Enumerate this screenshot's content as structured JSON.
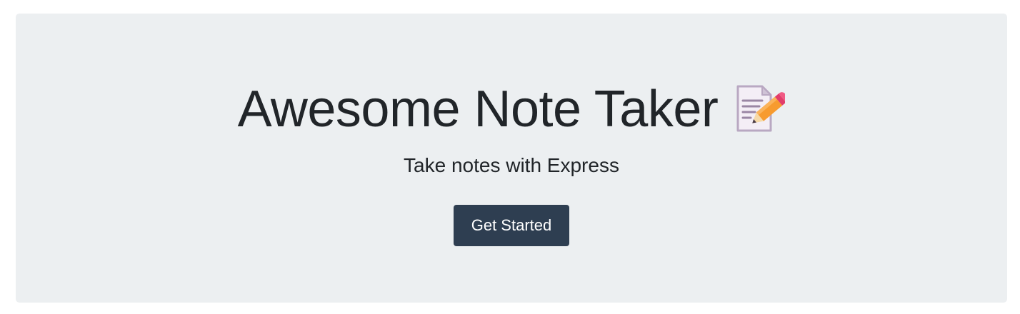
{
  "hero": {
    "title": "Awesome Note Taker",
    "icon": "memo-pencil-icon",
    "subtitle": "Take notes with Express",
    "cta_label": "Get Started"
  },
  "colors": {
    "page_background": "#ffffff",
    "jumbotron_background": "#eceff1",
    "text": "#212529",
    "button_background": "#2e3e51",
    "button_text": "#ffffff"
  }
}
